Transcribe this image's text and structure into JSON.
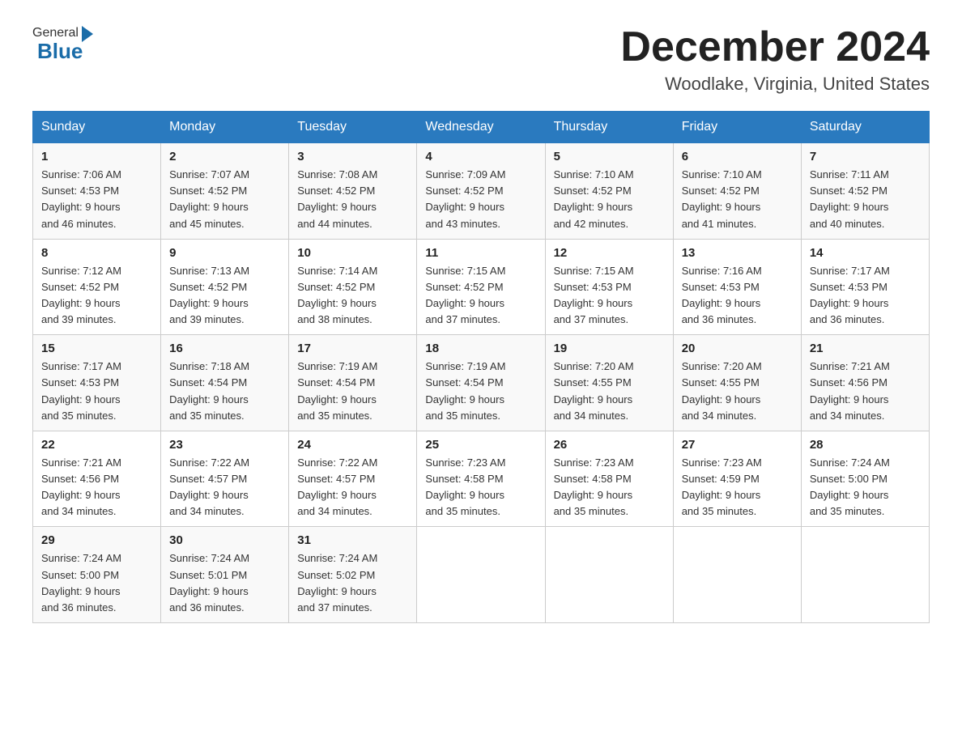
{
  "header": {
    "month_title": "December 2024",
    "location": "Woodlake, Virginia, United States"
  },
  "logo": {
    "general": "General",
    "blue": "Blue"
  },
  "days_of_week": [
    "Sunday",
    "Monday",
    "Tuesday",
    "Wednesday",
    "Thursday",
    "Friday",
    "Saturday"
  ],
  "weeks": [
    [
      {
        "date": "1",
        "sunrise": "7:06 AM",
        "sunset": "4:53 PM",
        "daylight": "9 hours and 46 minutes."
      },
      {
        "date": "2",
        "sunrise": "7:07 AM",
        "sunset": "4:52 PM",
        "daylight": "9 hours and 45 minutes."
      },
      {
        "date": "3",
        "sunrise": "7:08 AM",
        "sunset": "4:52 PM",
        "daylight": "9 hours and 44 minutes."
      },
      {
        "date": "4",
        "sunrise": "7:09 AM",
        "sunset": "4:52 PM",
        "daylight": "9 hours and 43 minutes."
      },
      {
        "date": "5",
        "sunrise": "7:10 AM",
        "sunset": "4:52 PM",
        "daylight": "9 hours and 42 minutes."
      },
      {
        "date": "6",
        "sunrise": "7:10 AM",
        "sunset": "4:52 PM",
        "daylight": "9 hours and 41 minutes."
      },
      {
        "date": "7",
        "sunrise": "7:11 AM",
        "sunset": "4:52 PM",
        "daylight": "9 hours and 40 minutes."
      }
    ],
    [
      {
        "date": "8",
        "sunrise": "7:12 AM",
        "sunset": "4:52 PM",
        "daylight": "9 hours and 39 minutes."
      },
      {
        "date": "9",
        "sunrise": "7:13 AM",
        "sunset": "4:52 PM",
        "daylight": "9 hours and 39 minutes."
      },
      {
        "date": "10",
        "sunrise": "7:14 AM",
        "sunset": "4:52 PM",
        "daylight": "9 hours and 38 minutes."
      },
      {
        "date": "11",
        "sunrise": "7:15 AM",
        "sunset": "4:52 PM",
        "daylight": "9 hours and 37 minutes."
      },
      {
        "date": "12",
        "sunrise": "7:15 AM",
        "sunset": "4:53 PM",
        "daylight": "9 hours and 37 minutes."
      },
      {
        "date": "13",
        "sunrise": "7:16 AM",
        "sunset": "4:53 PM",
        "daylight": "9 hours and 36 minutes."
      },
      {
        "date": "14",
        "sunrise": "7:17 AM",
        "sunset": "4:53 PM",
        "daylight": "9 hours and 36 minutes."
      }
    ],
    [
      {
        "date": "15",
        "sunrise": "7:17 AM",
        "sunset": "4:53 PM",
        "daylight": "9 hours and 35 minutes."
      },
      {
        "date": "16",
        "sunrise": "7:18 AM",
        "sunset": "4:54 PM",
        "daylight": "9 hours and 35 minutes."
      },
      {
        "date": "17",
        "sunrise": "7:19 AM",
        "sunset": "4:54 PM",
        "daylight": "9 hours and 35 minutes."
      },
      {
        "date": "18",
        "sunrise": "7:19 AM",
        "sunset": "4:54 PM",
        "daylight": "9 hours and 35 minutes."
      },
      {
        "date": "19",
        "sunrise": "7:20 AM",
        "sunset": "4:55 PM",
        "daylight": "9 hours and 34 minutes."
      },
      {
        "date": "20",
        "sunrise": "7:20 AM",
        "sunset": "4:55 PM",
        "daylight": "9 hours and 34 minutes."
      },
      {
        "date": "21",
        "sunrise": "7:21 AM",
        "sunset": "4:56 PM",
        "daylight": "9 hours and 34 minutes."
      }
    ],
    [
      {
        "date": "22",
        "sunrise": "7:21 AM",
        "sunset": "4:56 PM",
        "daylight": "9 hours and 34 minutes."
      },
      {
        "date": "23",
        "sunrise": "7:22 AM",
        "sunset": "4:57 PM",
        "daylight": "9 hours and 34 minutes."
      },
      {
        "date": "24",
        "sunrise": "7:22 AM",
        "sunset": "4:57 PM",
        "daylight": "9 hours and 34 minutes."
      },
      {
        "date": "25",
        "sunrise": "7:23 AM",
        "sunset": "4:58 PM",
        "daylight": "9 hours and 35 minutes."
      },
      {
        "date": "26",
        "sunrise": "7:23 AM",
        "sunset": "4:58 PM",
        "daylight": "9 hours and 35 minutes."
      },
      {
        "date": "27",
        "sunrise": "7:23 AM",
        "sunset": "4:59 PM",
        "daylight": "9 hours and 35 minutes."
      },
      {
        "date": "28",
        "sunrise": "7:24 AM",
        "sunset": "5:00 PM",
        "daylight": "9 hours and 35 minutes."
      }
    ],
    [
      {
        "date": "29",
        "sunrise": "7:24 AM",
        "sunset": "5:00 PM",
        "daylight": "9 hours and 36 minutes."
      },
      {
        "date": "30",
        "sunrise": "7:24 AM",
        "sunset": "5:01 PM",
        "daylight": "9 hours and 36 minutes."
      },
      {
        "date": "31",
        "sunrise": "7:24 AM",
        "sunset": "5:02 PM",
        "daylight": "9 hours and 37 minutes."
      },
      null,
      null,
      null,
      null
    ]
  ],
  "labels": {
    "sunrise": "Sunrise: ",
    "sunset": "Sunset: ",
    "daylight": "Daylight: "
  }
}
